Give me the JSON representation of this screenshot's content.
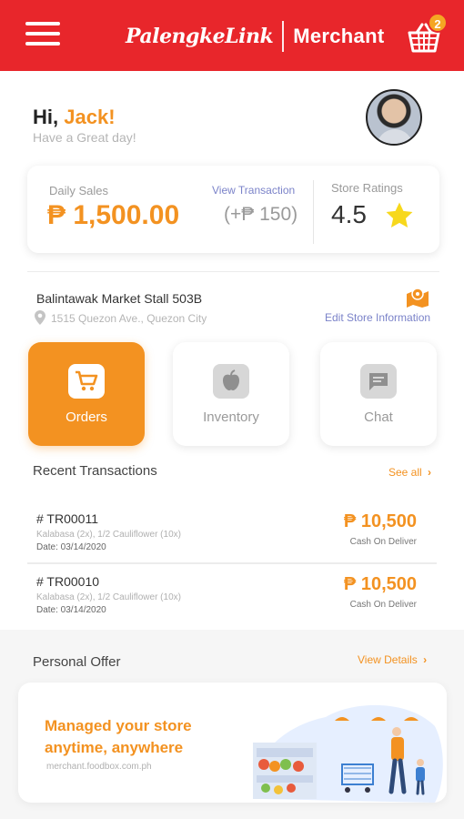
{
  "header": {
    "logo_text": "PalengkeLink",
    "logo_section": "Merchant",
    "cart_count": "2",
    "brand_color": "#e8262b",
    "accent_color": "#f39221"
  },
  "greeting": {
    "hi": "Hi,",
    "name": "Jack!",
    "subtitle": "Have a Great day!"
  },
  "sales": {
    "label": "Daily Sales",
    "value": "₱ 1,500.00",
    "view_link": "View Transaction",
    "delta": "(+₱ 150)",
    "rating_label": "Store Ratings",
    "rating_value": "4.5"
  },
  "store": {
    "name": "Balintawak Market Stall 503B",
    "address": "1515 Quezon Ave., Quezon City",
    "edit_link": "Edit Store Information"
  },
  "tiles": [
    {
      "label": "Orders",
      "icon": "cart-icon",
      "active": true
    },
    {
      "label": "Inventory",
      "icon": "apple-icon",
      "active": false
    },
    {
      "label": "Chat",
      "icon": "chat-icon",
      "active": false
    }
  ],
  "recent": {
    "title": "Recent Transactions",
    "see_all": "See all",
    "items": [
      {
        "id": "# TR00011",
        "items": "Kalabasa (2x), 1/2 Cauliflower (10x)",
        "date": "Date: 03/14/2020",
        "amount": "₱ 10,500",
        "method": "Cash On Deliver"
      },
      {
        "id": "# TR00010",
        "items": "Kalabasa (2x), 1/2 Cauliflower (10x)",
        "date": "Date: 03/14/2020",
        "amount": "₱ 10,500",
        "method": "Cash On Deliver"
      }
    ]
  },
  "offer": {
    "title": "Personal Offer",
    "view_details": "View Details",
    "headline": "Managed your store anytime, anywhere",
    "url": "merchant.foodbox.com.ph"
  }
}
